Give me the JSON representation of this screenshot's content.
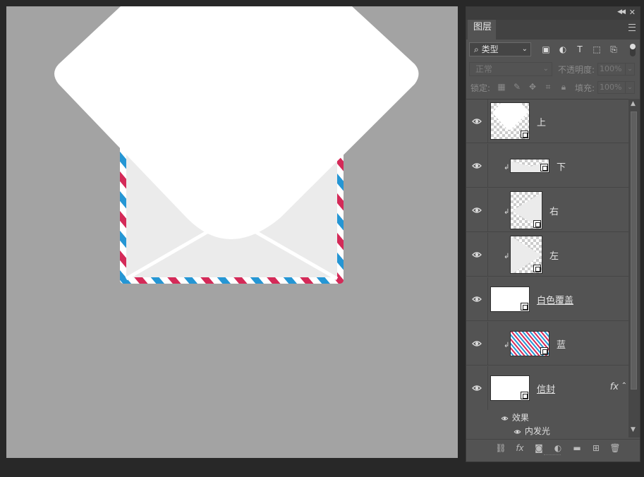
{
  "canvas": {
    "background": "#a3a3a3"
  },
  "panel": {
    "tab": "图层",
    "filter": {
      "label": "类型",
      "search_glyph": "⌕",
      "icons": [
        "image-filter-icon",
        "adjustment-filter-icon",
        "type-filter-icon",
        "shape-filter-icon",
        "smart-object-filter-icon"
      ]
    },
    "blend_mode": "正常",
    "opacity_label": "不透明度:",
    "opacity_value": "100%",
    "lock_label": "锁定:",
    "fill_label": "填充:",
    "fill_value": "100%",
    "layers": [
      {
        "name": "上",
        "clipped": false,
        "thumb": "diamond"
      },
      {
        "name": "下",
        "clipped": true,
        "thumb": "strip"
      },
      {
        "name": "右",
        "clipped": true,
        "thumb": "right-tri"
      },
      {
        "name": "左",
        "clipped": true,
        "thumb": "left-tri"
      },
      {
        "name": "白色覆盖",
        "clipped": false,
        "thumb": "white"
      },
      {
        "name": "蓝",
        "clipped": true,
        "thumb": "stripes"
      },
      {
        "name": "信封",
        "clipped": false,
        "thumb": "white",
        "fx": "fx"
      }
    ],
    "effects_label": "效果",
    "effect_items": [
      "内发光"
    ]
  },
  "colors": {
    "stripe_red": "#d42a58",
    "stripe_blue": "#2596d4",
    "envelope": "#ebebeb"
  }
}
